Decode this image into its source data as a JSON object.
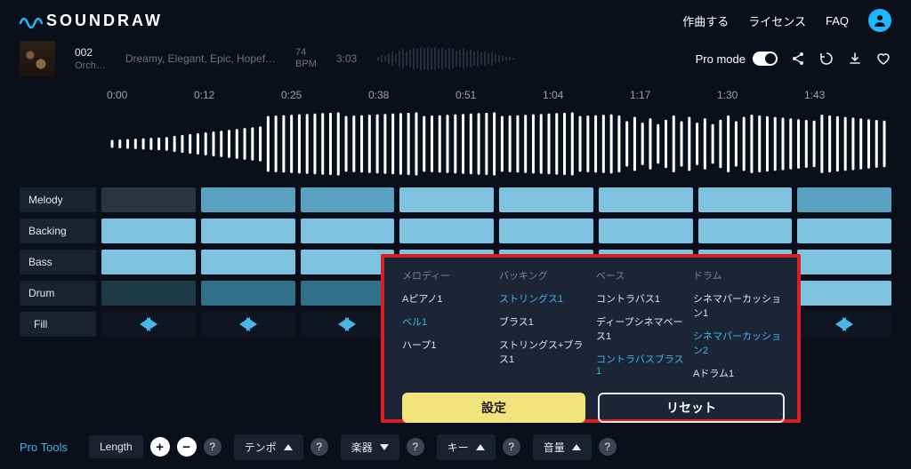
{
  "brand": "SOUNDRAW",
  "nav": {
    "compose": "作曲する",
    "license": "ライセンス",
    "faq": "FAQ"
  },
  "track": {
    "title": "002",
    "subtitle": "Orch…",
    "tags": "Dreamy, Elegant, Epic, Hopef…",
    "bpm_value": "74",
    "bpm_label": "BPM",
    "duration": "3:03"
  },
  "pro_mode_label": "Pro mode",
  "ruler": [
    "0:00",
    "0:12",
    "0:25",
    "0:38",
    "0:51",
    "1:04",
    "1:17",
    "1:30",
    "1:43"
  ],
  "rows": {
    "melody": {
      "label": "Melody",
      "cells": [
        "a0",
        "a1",
        "a1",
        "a2",
        "a2",
        "a2",
        "a2",
        "a1"
      ]
    },
    "backing": {
      "label": "Backing",
      "cells": [
        "a2",
        "a2",
        "a2",
        "a2",
        "a2",
        "a2",
        "a2",
        "a2"
      ]
    },
    "bass": {
      "label": "Bass",
      "cells": [
        "a2",
        "a2",
        "a2",
        "a2",
        "a2",
        "a2",
        "a2",
        "a2"
      ]
    },
    "drum": {
      "label": "Drum",
      "cells": [
        "a4",
        "a3",
        "a3",
        "a3",
        "a3",
        "a3",
        "a3",
        "a2"
      ]
    },
    "fill": {
      "label": "Fill"
    }
  },
  "popup": {
    "cols": [
      {
        "head": "メロディー",
        "items": [
          {
            "t": "Aピアノ1",
            "sel": false
          },
          {
            "t": "ベル1",
            "sel": true
          },
          {
            "t": "ハープ1",
            "sel": false
          }
        ]
      },
      {
        "head": "バッキング",
        "items": [
          {
            "t": "ストリングス1",
            "sel": true
          },
          {
            "t": "ブラス1",
            "sel": false
          },
          {
            "t": "ストリングス+ブラス1",
            "sel": false
          }
        ]
      },
      {
        "head": "ベース",
        "items": [
          {
            "t": "コントラバス1",
            "sel": false
          },
          {
            "t": "ディープシネマベース1",
            "sel": false
          },
          {
            "t": "コントラバスブラス1",
            "sel": true
          }
        ]
      },
      {
        "head": "ドラム",
        "items": [
          {
            "t": "シネマパーカッション1",
            "sel": false
          },
          {
            "t": "シネマパーカッション2",
            "sel": true
          },
          {
            "t": "Aドラム1",
            "sel": false
          }
        ]
      }
    ],
    "apply": "設定",
    "reset": "リセット"
  },
  "pro_tools": {
    "label": "Pro Tools",
    "length": "Length",
    "tempo": "テンポ",
    "instrument": "楽器",
    "key": "キー",
    "volume": "音量"
  }
}
